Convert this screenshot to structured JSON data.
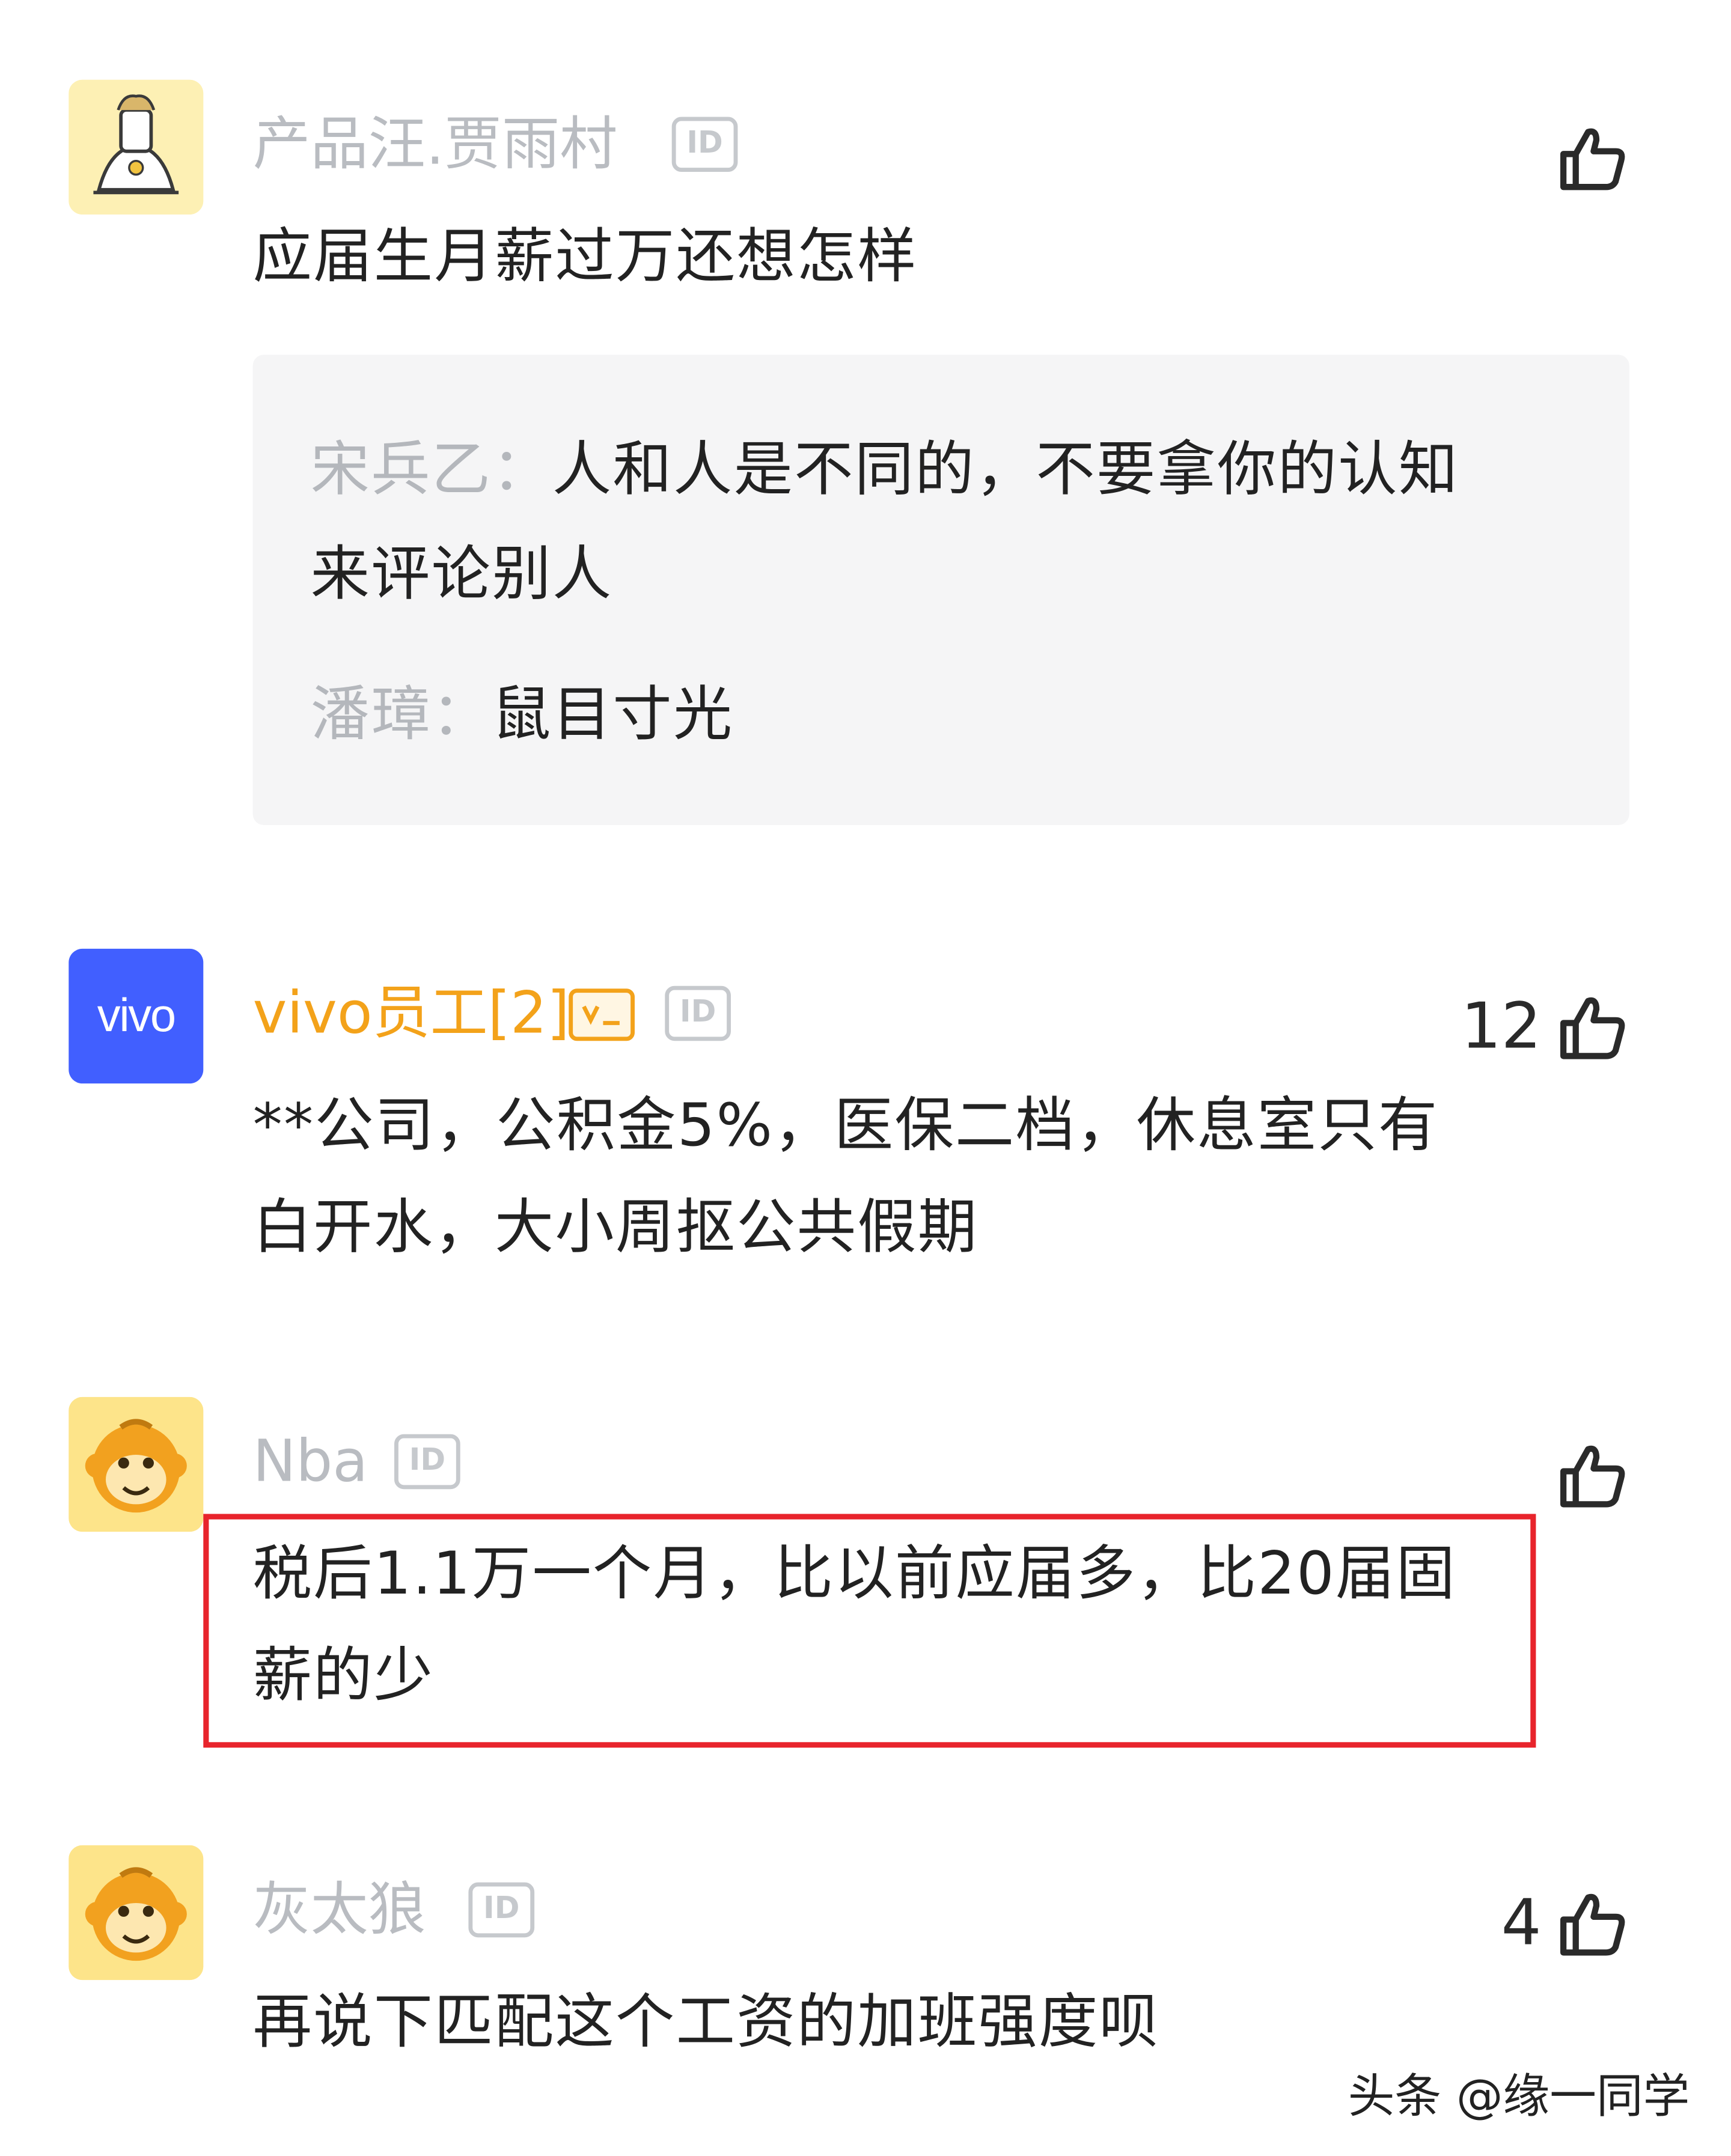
{
  "comments": [
    {
      "username": "产品汪.贾雨村",
      "id_badge": "ID",
      "avatar_icon": "lightbulb-figure-icon",
      "likes": "",
      "text": "应届生月薪过万还想怎样",
      "replies": [
        {
          "name": "宋兵乙：",
          "text": "人和人是不同的，不要拿你的认知",
          "text2": "来评论别人"
        },
        {
          "name": "潘璋：",
          "text": "鼠目寸光"
        }
      ]
    },
    {
      "username": "vivo员工[2]",
      "id_badge": "ID",
      "avatar_label": "vivo",
      "likes": "12",
      "text_line1": "**公司，公积金5%，医保二档，休息室只有",
      "text_line2": "白开水，大小周抠公共假期"
    },
    {
      "username": "Nba",
      "id_badge": "ID",
      "avatar_icon": "monkey-face-icon",
      "likes": "",
      "text_line1": "税后1.1万一个月，比以前应届多，比20届固",
      "text_line2": "薪的少"
    },
    {
      "username": "灰太狼",
      "id_badge": "ID",
      "avatar_icon": "monkey-face-icon",
      "likes": "4",
      "text": "再说下匹配这个工资的加班强度呗"
    }
  ],
  "watermark": "头条 @缘一同学",
  "colors": {
    "username_gray": "#b9bcc1",
    "username_vip": "#f3a21a",
    "vivo_blue": "#415fff",
    "highlight_red": "#e8242c",
    "reply_bg": "#f5f5f6"
  },
  "icons": {
    "like": "thumbs-up-icon",
    "id": "id-badge-icon",
    "vip": "vip-badge-icon"
  }
}
